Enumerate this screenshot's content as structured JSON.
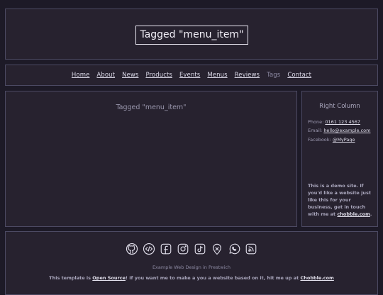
{
  "header": {
    "site_title": "Tagged \"menu_item\""
  },
  "nav": {
    "items": [
      {
        "label": "Home"
      },
      {
        "label": "About"
      },
      {
        "label": "News"
      },
      {
        "label": "Products"
      },
      {
        "label": "Events"
      },
      {
        "label": "Menus"
      },
      {
        "label": "Reviews"
      },
      {
        "label": "Tags",
        "current": true
      },
      {
        "label": "Contact"
      }
    ]
  },
  "main": {
    "title": "Tagged \"menu_item\""
  },
  "sidebar": {
    "title": "Right Column",
    "phone_label": "Phone:",
    "phone_value": "0161 123 4567",
    "email_label": "Email:",
    "email_value": "hello@example.com",
    "facebook_label": "Facebook:",
    "facebook_value": "@MyPage",
    "demo_text": "This is a demo site. If you'd like a website just like this for your business, get in touch with me at",
    "demo_link": "chobble.com",
    "demo_end": "."
  },
  "footer": {
    "social_icons": [
      "github-icon",
      "code-icon",
      "facebook-icon",
      "instagram-icon",
      "tiktok-icon",
      "map-pin-icon",
      "whatsapp-icon",
      "rss-icon"
    ],
    "credit": "Example Web Design in Prestwich",
    "note_part1": "This template is",
    "note_link1": "Open Source",
    "note_part2": "! If you want me to make a you a website based on it, hit me up at",
    "note_link2": "Chobble.com"
  },
  "colors": {
    "background": "#1d1a27",
    "panel": "#27222f",
    "border": "#4c4a63",
    "text": "#cfcde0"
  }
}
